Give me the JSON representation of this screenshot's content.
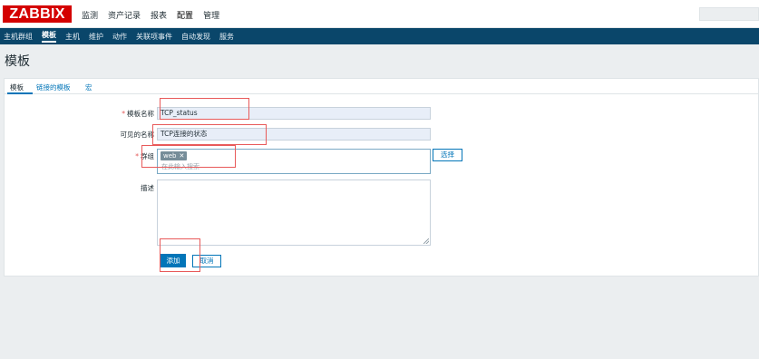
{
  "brand": {
    "logo_text": "ZABBIX"
  },
  "main_menu": [
    "监测",
    "资产记录",
    "报表",
    "配置",
    "管理"
  ],
  "sub_menu": [
    "主机群组",
    "模板",
    "主机",
    "维护",
    "动作",
    "关联项事件",
    "自动发现",
    "服务"
  ],
  "page": {
    "title": "模板"
  },
  "tabs": [
    "模板",
    "链接的模板",
    "宏"
  ],
  "form": {
    "template_name": {
      "label": "模板名称",
      "required": "*",
      "value": "TCP_status"
    },
    "visible_name": {
      "label": "可见的名称",
      "value": "TCP连接的状态"
    },
    "groups": {
      "label": "群组",
      "required": "*",
      "chip": "web",
      "chip_remove": "✕",
      "placeholder": "在此输入搜索",
      "select_label": "选择"
    },
    "description": {
      "label": "描述",
      "value": ""
    },
    "add_label": "添加",
    "cancel_label": "取消"
  },
  "colors": {
    "logo": "#d40000",
    "submenu_bg": "#0a466a",
    "accent": "#0275b8",
    "highlight": "#e85a5a"
  }
}
